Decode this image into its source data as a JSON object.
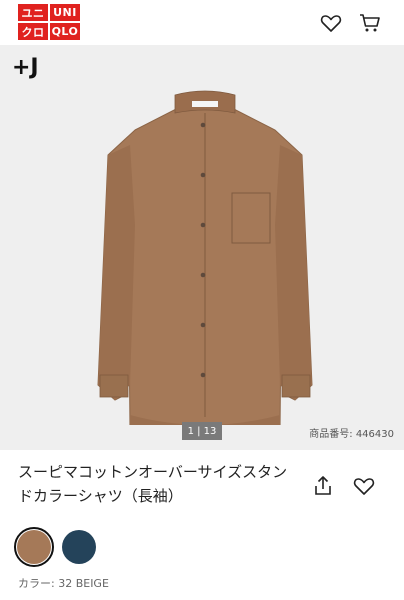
{
  "header": {
    "logo": [
      "ユニ",
      "UNI",
      "クロ",
      "QLO"
    ],
    "icons": [
      "heart-icon",
      "cart-icon"
    ]
  },
  "gallery": {
    "brand_mark": "+J",
    "counter": "1 | 13",
    "product_number": "商品番号: 446430",
    "image": "shirt-product-image"
  },
  "product": {
    "title_line1": "スーピマコットンオーバーサイズスタン",
    "title_line2": "ドカラーシャツ（長袖）",
    "actions": [
      "share-icon",
      "favorite-icon"
    ]
  },
  "colors": {
    "swatches": [
      {
        "name": "32 BEIGE",
        "hex": "#a57958"
      },
      {
        "name": "navy",
        "hex": "#24435a"
      }
    ],
    "selected_label": "カラー: 32 BEIGE"
  },
  "theme": {
    "brand_red": "#e0221f",
    "background": "#efefef"
  }
}
